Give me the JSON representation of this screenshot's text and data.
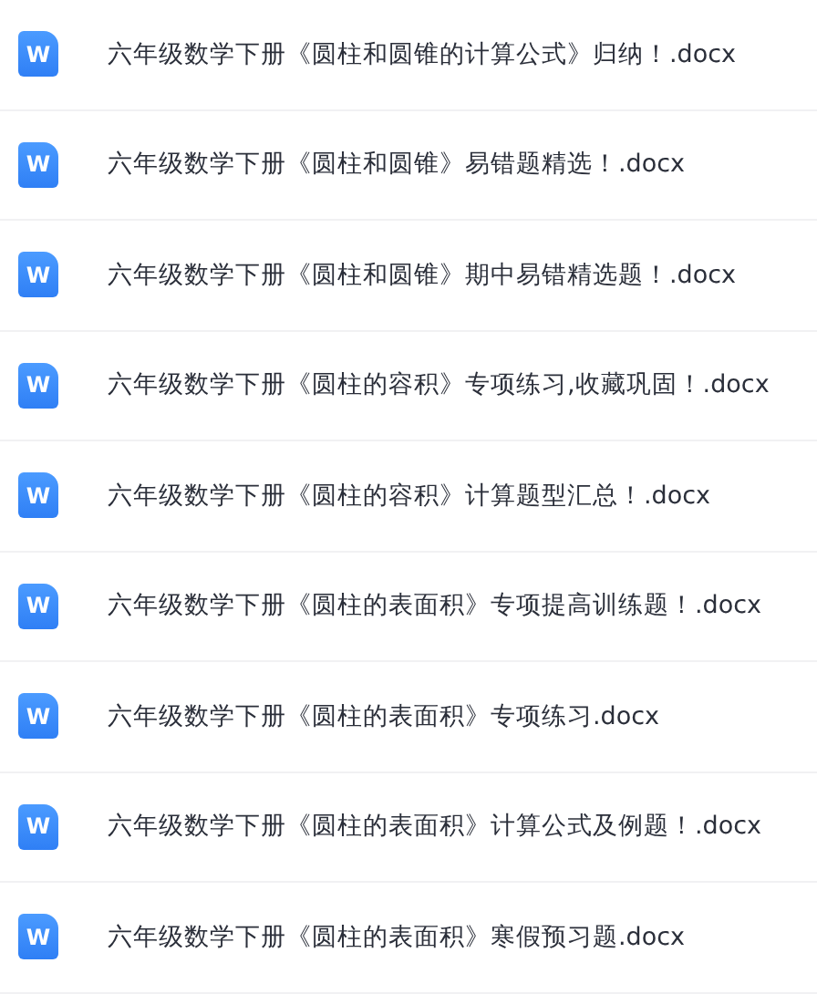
{
  "files": [
    {
      "icon_letter": "W",
      "name": "六年级数学下册《圆柱和圆锥的计算公式》归纳！.docx"
    },
    {
      "icon_letter": "W",
      "name": "六年级数学下册《圆柱和圆锥》易错题精选！.docx"
    },
    {
      "icon_letter": "W",
      "name": "六年级数学下册《圆柱和圆锥》期中易错精选题！.docx"
    },
    {
      "icon_letter": "W",
      "name": "六年级数学下册《圆柱的容积》专项练习,收藏巩固！.docx"
    },
    {
      "icon_letter": "W",
      "name": "六年级数学下册《圆柱的容积》计算题型汇总！.docx"
    },
    {
      "icon_letter": "W",
      "name": "六年级数学下册《圆柱的表面积》专项提高训练题！.docx"
    },
    {
      "icon_letter": "W",
      "name": "六年级数学下册《圆柱的表面积》专项练习.docx"
    },
    {
      "icon_letter": "W",
      "name": "六年级数学下册《圆柱的表面积》计算公式及例题！.docx"
    },
    {
      "icon_letter": "W",
      "name": "六年级数学下册《圆柱的表面积》寒假预习题.docx"
    }
  ]
}
